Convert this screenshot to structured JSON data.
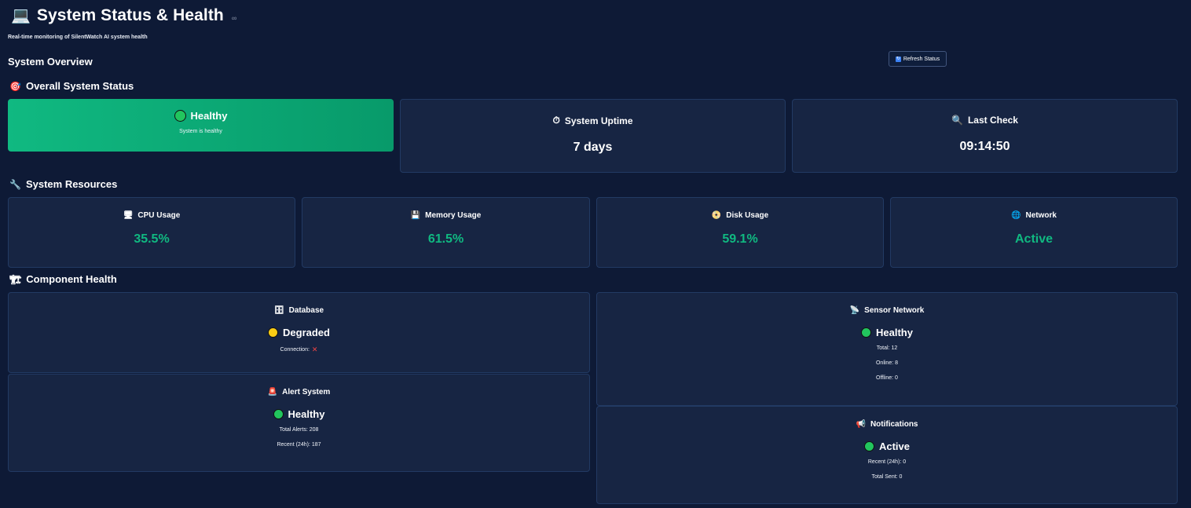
{
  "header": {
    "title": "System Status & Health",
    "subtitle": "Real-time monitoring of SilentWatch AI system health",
    "title_icon": "laptop-icon",
    "link_icon": "link-icon"
  },
  "overview": {
    "label": "System Overview",
    "refresh_label": "Refresh Status"
  },
  "overall_status": {
    "label": "Overall System Status",
    "status": "Healthy",
    "message": "System is healthy",
    "uptime_label": "System Uptime",
    "uptime_value": "7 days",
    "last_check_label": "Last Check",
    "last_check_value": "09:14:50"
  },
  "resources": {
    "label": "System Resources",
    "cpu_label": "CPU Usage",
    "cpu_value": "35.5%",
    "memory_label": "Memory Usage",
    "memory_value": "61.5%",
    "disk_label": "Disk Usage",
    "disk_value": "59.1%",
    "network_label": "Network",
    "network_value": "Active"
  },
  "components": {
    "label": "Component Health",
    "database": {
      "title": "Database",
      "status": "Degraded",
      "connection_label": "Connection:",
      "connection_value": "✕"
    },
    "alert_system": {
      "title": "Alert System",
      "status": "Healthy",
      "total": "Total Alerts: 208",
      "recent": "Recent (24h): 187"
    },
    "sensor_network": {
      "title": "Sensor Network",
      "status": "Healthy",
      "total": "Total: 12",
      "online": "Online: 8",
      "offline": "Offline: 0"
    },
    "notifications": {
      "title": "Notifications",
      "status": "Active",
      "recent": "Recent (24h): 0",
      "total_sent": "Total Sent: 0"
    }
  },
  "colors": {
    "background": "#0e1a36",
    "card": "#172543",
    "healthy_green": "#10b981",
    "status_green": "#22c55e",
    "degraded_yellow": "#facc15",
    "error_red": "#ef4444"
  }
}
